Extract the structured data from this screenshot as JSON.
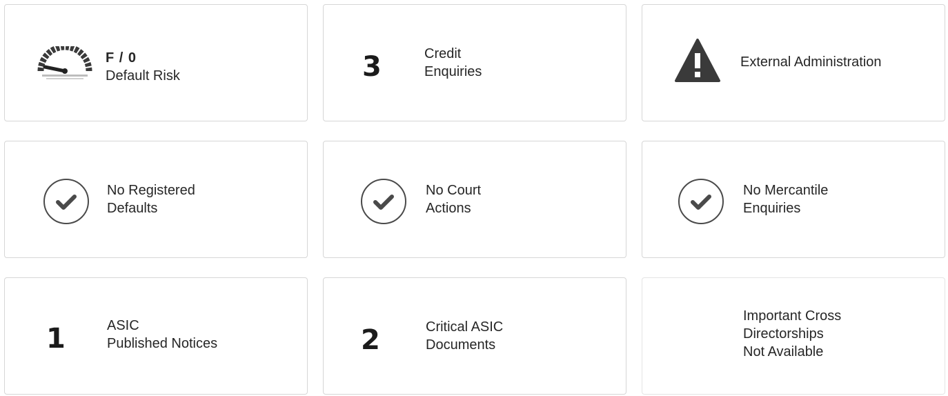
{
  "cards": [
    {
      "id": "default-risk",
      "icon": "gauge-icon",
      "heading": "F / 0",
      "label": "Default Risk"
    },
    {
      "id": "credit-enquiries",
      "number": "3",
      "lines": [
        "Credit",
        "Enquiries"
      ]
    },
    {
      "id": "external-administration",
      "icon": "warning-icon",
      "lines": [
        "External Administration"
      ]
    },
    {
      "id": "registered-defaults",
      "icon": "checkmark-circle-icon",
      "lines": [
        "No Registered",
        "Defaults"
      ]
    },
    {
      "id": "court-actions",
      "icon": "checkmark-circle-icon",
      "lines": [
        "No Court",
        "Actions"
      ]
    },
    {
      "id": "mercantile-enquiries",
      "icon": "checkmark-circle-icon",
      "lines": [
        "No Mercantile",
        "Enquiries"
      ]
    },
    {
      "id": "asic-published-notices",
      "number": "1",
      "lines": [
        "ASIC",
        "Published Notices"
      ]
    },
    {
      "id": "critical-asic-documents",
      "number": "2",
      "lines": [
        "Critical ASIC",
        "Documents"
      ]
    },
    {
      "id": "cross-directorships",
      "lines": [
        "Important Cross",
        "Directorships",
        "Not Available"
      ]
    }
  ],
  "colors": {
    "border": "#d6d6d6",
    "text": "#262626",
    "icon_dark": "#3a3a3a",
    "check_ring": "#4a4a4a"
  }
}
